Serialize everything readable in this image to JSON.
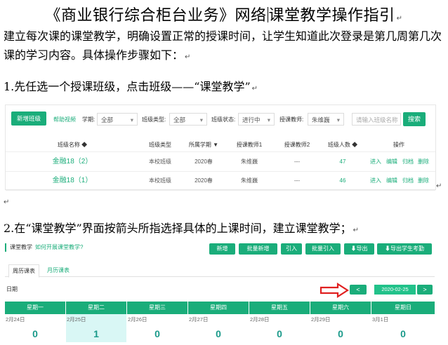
{
  "document": {
    "title": "《商业银行综合柜台业务》网络课堂教学操作指引",
    "title_part_a": "《商业银行综合柜台业务》网络",
    "title_part_b": "课堂教学操作指引",
    "para_mark": "↵",
    "para1": "建立每次课的课堂教学，明确设置正常的授课时间，让学生知道此次登录是第几周第几次课的学习内容。具体操作步骤如下：",
    "step1": "1.先任选一个授课班级，点击班级——“课堂教学”",
    "step2": "2.在“课堂教学”界面按箭头所指选择具体的上课时间，建立课堂教学；"
  },
  "screenshot1": {
    "add_class_button": "新增班级",
    "help_link": "帮助视频",
    "filters": [
      {
        "label": "学期:",
        "value": "全部"
      },
      {
        "label": "班级类型:",
        "value": "全部"
      },
      {
        "label": "班级状态:",
        "value": "进行中"
      },
      {
        "label": "授课教师:",
        "value": "朱维巍"
      }
    ],
    "search_placeholder": "请输入班级名称",
    "search_button": "搜索",
    "columns": [
      "班级名称 ◆",
      "班级类型",
      "所属学期 ▼",
      "授课教师1",
      "授课教师2",
      "班级人数 ◆",
      "操作"
    ],
    "rows": [
      {
        "name": "金融18（2）",
        "type": "本校班级",
        "term": "2020春",
        "teacher1": "朱维巍",
        "teacher2": "---",
        "count": "47",
        "actions": [
          "进入",
          "编辑",
          "归档",
          "删除"
        ]
      },
      {
        "name": "金融18（1）",
        "type": "本校班级",
        "term": "2020春",
        "teacher1": "朱维巍",
        "teacher2": "---",
        "count": "46",
        "actions": [
          "进入",
          "编辑",
          "归档",
          "删除"
        ]
      }
    ]
  },
  "screenshot2": {
    "breadcrumb": "课堂教学",
    "help_link": "如何开展课堂教学?",
    "toolbar": [
      "新增",
      "批量新增",
      "引入",
      "批量引入",
      "导出",
      "导出学生考勤"
    ],
    "tabs": [
      "周历课表",
      "月历课表"
    ],
    "date_label": "日期",
    "prev": "<",
    "next": ">",
    "current_date": "2020-02-25",
    "days": [
      {
        "weekday": "星期一",
        "date": "2月24日",
        "count": "0"
      },
      {
        "weekday": "星期二",
        "date": "2月25日",
        "count": "1"
      },
      {
        "weekday": "星期三",
        "date": "2月26日",
        "count": "0"
      },
      {
        "weekday": "星期四",
        "date": "2月27日",
        "count": "0"
      },
      {
        "weekday": "星期五",
        "date": "2月28日",
        "count": "0"
      },
      {
        "weekday": "星期六",
        "date": "2月29日",
        "count": "0"
      },
      {
        "weekday": "星期日",
        "date": "3月1日",
        "count": "0"
      }
    ],
    "highlight_color": "#d9f7f5",
    "accent_color": "#1aad7a",
    "arrow_color": "#e02020"
  }
}
